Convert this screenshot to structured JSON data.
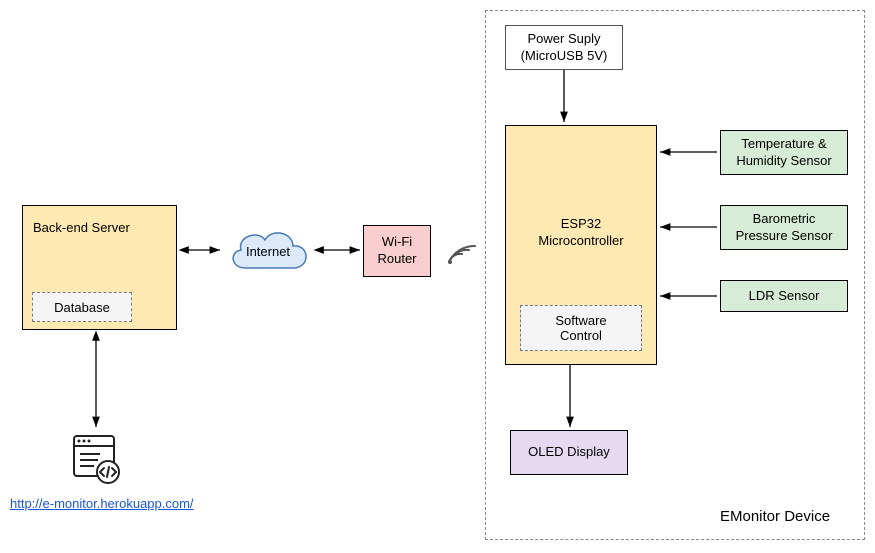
{
  "device": {
    "frame_label": "EMonitor Device",
    "power": {
      "line1": "Power Suply",
      "line2": "(MicroUSB 5V)"
    },
    "mcu": {
      "title": "ESP32\nMicrocontroller",
      "software": "Software\nControl"
    },
    "sensors": {
      "temp_humidity": "Temperature &\nHumidity Sensor",
      "barometric": "Barometric\nPressure Sensor",
      "ldr": "LDR Sensor"
    },
    "oled": "OLED Display"
  },
  "wifi_router": "Wi-Fi\nRouter",
  "internet": "Internet",
  "backend": {
    "title": "Back-end Server",
    "database": "Database"
  },
  "url": "http://e-monitor.herokuapp.com/",
  "icons": {
    "cloud": "cloud-icon",
    "wifi": "wifi-signal-icon",
    "web": "web-code-icon"
  },
  "colors": {
    "yellow": "#ffe9b3",
    "green": "#d7ecd6",
    "pink": "#f8cfce",
    "purple": "#e5daf2",
    "cloud_fill": "#dbe9f9",
    "cloud_stroke": "#4a7ab4"
  }
}
